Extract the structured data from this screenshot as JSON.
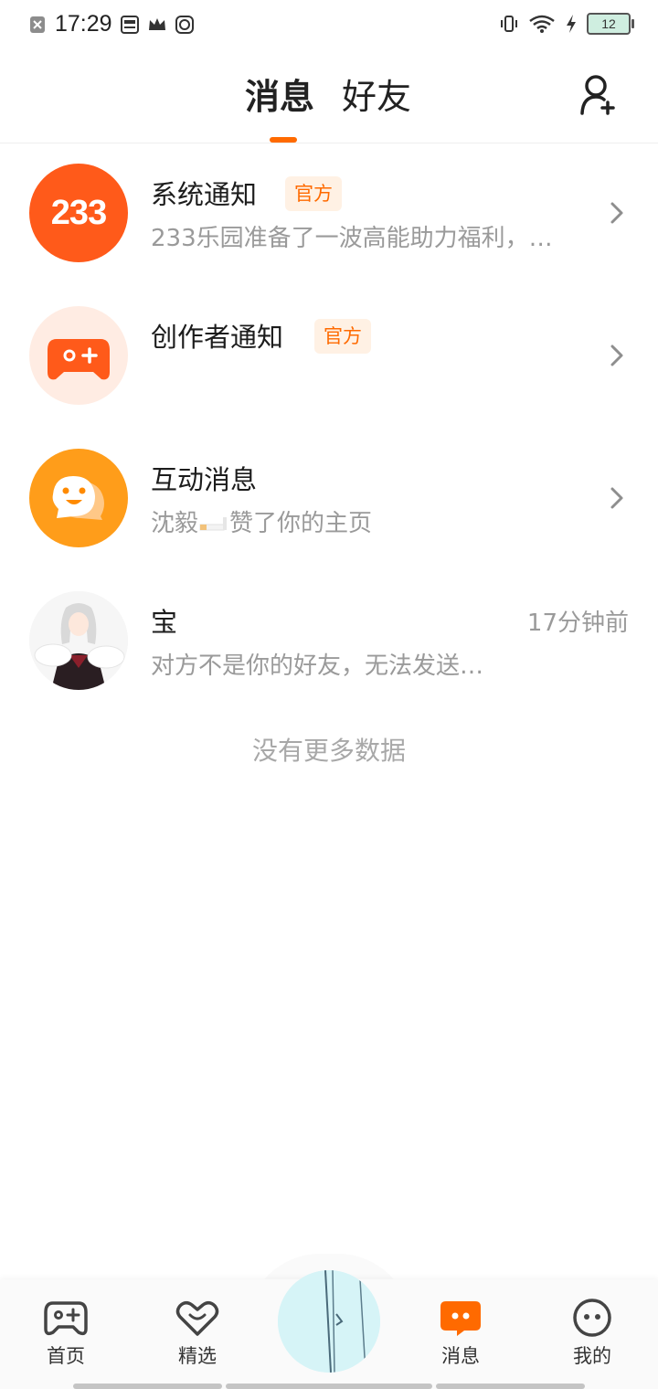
{
  "status_bar": {
    "time": "17:29",
    "battery": "12",
    "icons": [
      "sim-off-icon",
      "news-icon",
      "crown-icon",
      "sync-icon",
      "vibrate-icon",
      "wifi-icon",
      "charging-icon"
    ]
  },
  "header": {
    "tabs": [
      {
        "label": "消息",
        "active": true
      },
      {
        "label": "好友",
        "active": false
      }
    ],
    "add_friend_icon": "add-user-icon"
  },
  "conversations": [
    {
      "title": "系统通知",
      "badge": "官方",
      "subtitle": "233乐园准备了一波高能助力福利，…",
      "avatar_text": "233",
      "avatar_color": "#ff5a1a"
    },
    {
      "title": "创作者通知",
      "badge": "官方",
      "subtitle": "",
      "avatar_icon": "gamepad-icon",
      "avatar_color": "#ffece3"
    },
    {
      "title": "互动消息",
      "subtitle_name": "沈毅",
      "subtitle_action": "赞了你的主页",
      "avatar_icon": "chat-bubble-icon",
      "avatar_color": "#ff9d1a"
    },
    {
      "title": "宝",
      "time": "17分钟前",
      "subtitle": "对方不是你的好友，无法发送…",
      "avatar_icon": "anime-avatar"
    }
  ],
  "no_more_text": "没有更多数据",
  "bottom_nav": [
    {
      "label": "首页",
      "icon": "gamepad-icon",
      "active": false
    },
    {
      "label": "精选",
      "icon": "heart-icon",
      "active": false
    },
    {
      "label": "",
      "icon": "center-thumbnail",
      "active": false
    },
    {
      "label": "消息",
      "icon": "message-icon",
      "active": true
    },
    {
      "label": "我的",
      "icon": "face-icon",
      "active": false
    }
  ],
  "colors": {
    "accent": "#ff6a00",
    "muted": "#9a9a9a",
    "text": "#1c1c1c"
  }
}
